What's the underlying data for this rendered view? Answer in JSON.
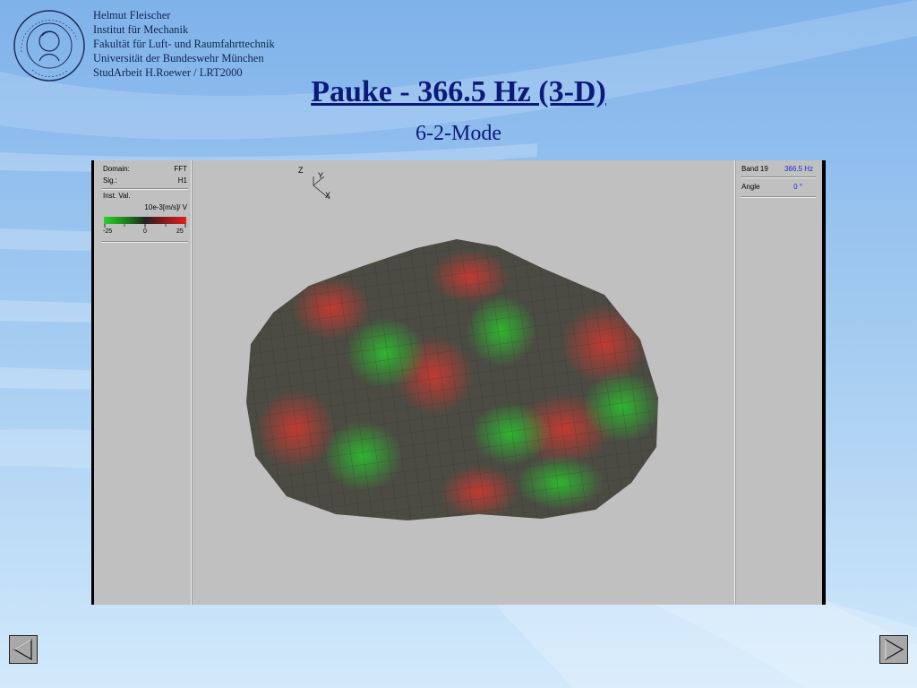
{
  "header": {
    "author_lines": [
      "Helmut Fleischer",
      "Institut für Mechanik",
      "Fakultät für Luft- und Raumfahrttechnik",
      "Universität der Bundeswehr München",
      "StudArbeit H.Roewer / LRT2000"
    ],
    "logo_text_top": "UNIVERSITÄT DER BUNDESWEHR",
    "logo_text_bottom": "MÜNCHEN"
  },
  "slide": {
    "title": "Pauke - 366.5 Hz (3-D)",
    "subtitle": "6-2-Mode"
  },
  "viewer": {
    "left_panel": {
      "domain_label": "Domain:",
      "domain_value": "FFT",
      "sig_label": "Sig.:",
      "sig_value": "H1",
      "inst_val_label": "Inst. Val.",
      "unit": "10e-3[m/s]/ V",
      "scale_min": "-25",
      "scale_mid": "0",
      "scale_max": "25"
    },
    "right_panel": {
      "band_label": "Band 19",
      "band_value": "366.5 Hz",
      "angle_label": "Angle",
      "angle_value": "0 °"
    },
    "axes": {
      "z": "Z",
      "y": "Y",
      "x": "X"
    },
    "colors": {
      "positive": "#c0302c",
      "negative": "#2eae2e",
      "neutral": "#4a4a42"
    }
  },
  "nav": {
    "prev_icon": "triangle-left-icon",
    "next_icon": "triangle-right-icon"
  }
}
